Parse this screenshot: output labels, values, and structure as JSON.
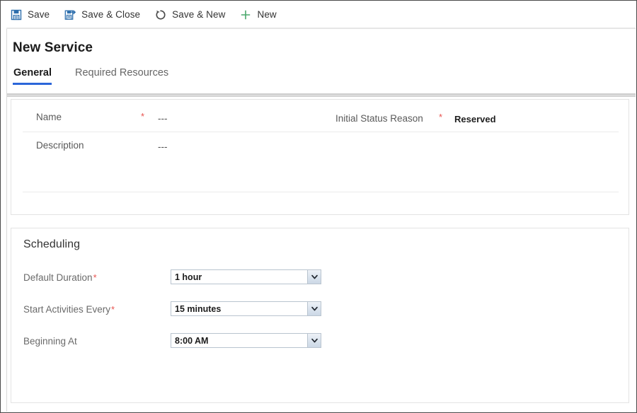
{
  "window": {
    "title": "New Service"
  },
  "commandbar": {
    "buttons": [
      {
        "label": "Save",
        "icon": "save-icon"
      },
      {
        "label": "Save & Close",
        "icon": "save-and-close-icon"
      },
      {
        "label": "Save & New",
        "icon": "save-and-new-icon"
      },
      {
        "label": "New",
        "icon": "plus-icon"
      }
    ]
  },
  "tabs": [
    {
      "label": "General",
      "active": true
    },
    {
      "label": "Required Resources",
      "active": false
    }
  ],
  "general": {
    "fields": [
      {
        "label": "Name",
        "required": true,
        "required_marker": "*",
        "value": "---"
      },
      {
        "label": "Initial Status Reason",
        "required": true,
        "required_marker": "*",
        "value": "Reserved"
      },
      {
        "label": "Description",
        "required": false,
        "required_marker": "",
        "value": "---"
      }
    ]
  },
  "scheduling": {
    "title": "Scheduling",
    "rows": [
      {
        "label": "Default Duration",
        "required": true,
        "required_marker": "*",
        "value": "1 hour"
      },
      {
        "label": "Start Activities Every",
        "required": true,
        "required_marker": "*",
        "value": "15 minutes"
      },
      {
        "label": "Beginning At",
        "required": false,
        "required_marker": "",
        "value": "8:00 AM"
      }
    ]
  },
  "colors": {
    "accent": "#2b66d9",
    "required": "#e8534f",
    "save_icon": "#2e6fad",
    "new_icon": "#4aa96c",
    "card_border": "#e3e3e3"
  }
}
